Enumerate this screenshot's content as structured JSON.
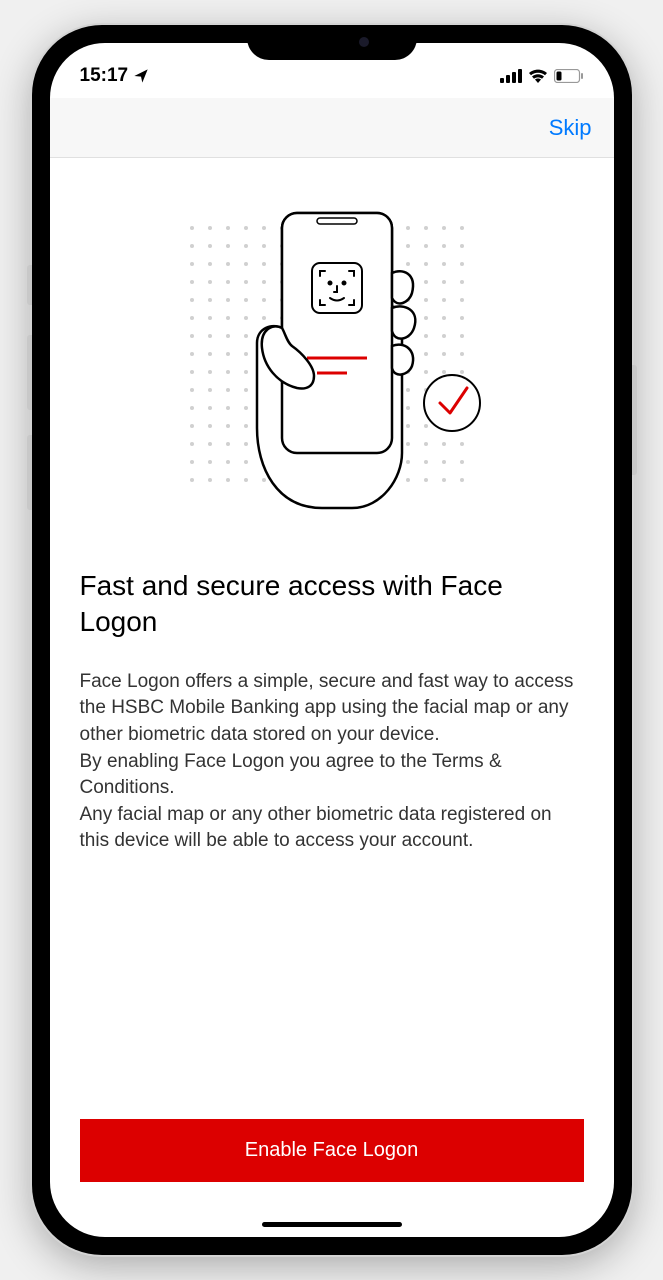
{
  "statusBar": {
    "time": "15:17"
  },
  "navBar": {
    "skipLabel": "Skip"
  },
  "content": {
    "heading": "Fast and secure access with Face Logon",
    "description": "Face Logon offers a simple, secure and fast way to access the HSBC Mobile Banking app using the facial map or any other biometric data stored on your device.\nBy enabling Face Logon you agree to the Terms & Conditions.\nAny  facial map or any other biometric data registered on this device will be able to access your account."
  },
  "buttons": {
    "enableLabel": "Enable Face Logon"
  }
}
